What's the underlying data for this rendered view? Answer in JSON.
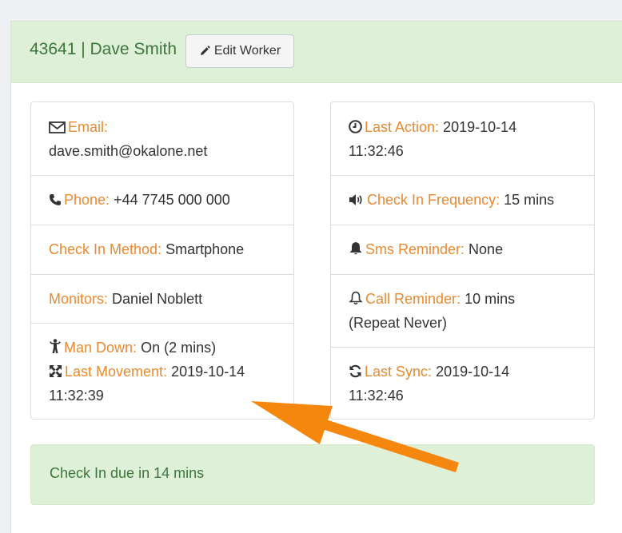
{
  "worker": {
    "title": "43641 | Dave Smith",
    "edit_label": "Edit Worker"
  },
  "left": {
    "email": {
      "label": "Email:",
      "value": "dave.smith@okalone.net",
      "icon": "envelope-icon"
    },
    "phone": {
      "label": "Phone:",
      "value": "+44 7745 000 000",
      "icon": "phone-icon"
    },
    "method": {
      "label": "Check In Method:",
      "value": "Smartphone"
    },
    "monitors": {
      "label": "Monitors:",
      "value": "Daniel Noblett"
    },
    "man_down": {
      "label": "Man Down:",
      "value": "On (2 mins)",
      "icon": "person-icon"
    },
    "last_movement": {
      "label": "Last Movement:",
      "value_date": "2019-10-14",
      "value_time": "11:32:39",
      "icon": "arrows-expand-icon"
    }
  },
  "right": {
    "last_action": {
      "label": "Last Action:",
      "value_date": "2019-10-14",
      "value_time": "11:32:46",
      "icon": "clock-icon"
    },
    "frequency": {
      "label": "Check In Frequency:",
      "value": "15 mins",
      "icon": "volume-icon"
    },
    "sms": {
      "label": "Sms Reminder:",
      "value": "None",
      "icon": "bell-solid-icon"
    },
    "call": {
      "label": "Call Reminder:",
      "value": "10 mins",
      "value2": "(Repeat Never)",
      "icon": "bell-outline-icon"
    },
    "sync": {
      "label": "Last Sync:",
      "value_date": "2019-10-14",
      "value_time": "11:32:46",
      "icon": "refresh-icon"
    }
  },
  "alert": {
    "text": "Check In due in 14 mins"
  },
  "colors": {
    "label": "#e88a2f",
    "success_text": "#3c763d",
    "success_bg": "#dff0d8",
    "arrow": "#f5870f"
  }
}
